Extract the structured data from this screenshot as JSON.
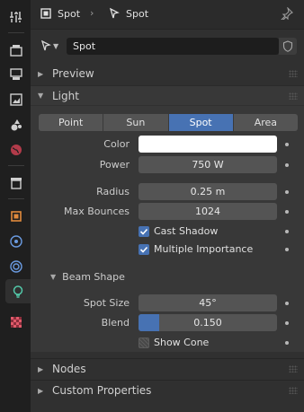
{
  "header": {
    "object_name": "Spot",
    "data_name": "Spot"
  },
  "datablock": {
    "name": "Spot"
  },
  "sections": {
    "preview": "Preview",
    "light": "Light",
    "nodes": "Nodes",
    "custom_properties": "Custom Properties"
  },
  "light_types": [
    {
      "label": "Point",
      "active": false
    },
    {
      "label": "Sun",
      "active": false
    },
    {
      "label": "Spot",
      "active": true
    },
    {
      "label": "Area",
      "active": false
    }
  ],
  "props": {
    "color_label": "Color",
    "color_value": "#ffffff",
    "power_label": "Power",
    "power_value": "750 W",
    "radius_label": "Radius",
    "radius_value": "0.25 m",
    "max_bounces_label": "Max Bounces",
    "max_bounces_value": "1024",
    "cast_shadow_label": "Cast Shadow",
    "cast_shadow_checked": true,
    "multiple_importance_label": "Multiple Importance",
    "multiple_importance_checked": true
  },
  "beam_shape": {
    "title": "Beam Shape",
    "spot_size_label": "Spot Size",
    "spot_size_value": "45°",
    "blend_label": "Blend",
    "blend_value": "0.150",
    "blend_fraction": 0.15,
    "show_cone_label": "Show Cone",
    "show_cone_checked": false
  },
  "colors": {
    "accent": "#4772b3",
    "panel": "#303030",
    "field": "#545454"
  }
}
